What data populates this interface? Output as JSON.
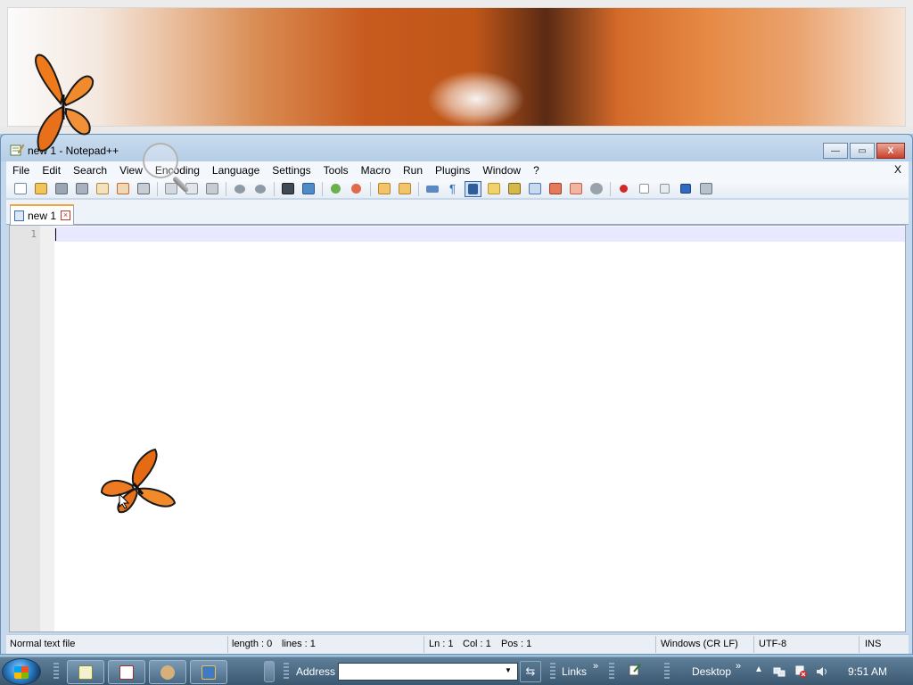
{
  "window": {
    "title": "new 1 - Notepad++",
    "close_label": "X",
    "minimize_label": "—",
    "maximize_label": "▭"
  },
  "menu": {
    "items": [
      "File",
      "Edit",
      "Search",
      "View",
      "Encoding",
      "Language",
      "Settings",
      "Tools",
      "Macro",
      "Run",
      "Plugins",
      "Window",
      "?"
    ],
    "close_label": "X"
  },
  "toolbar": {
    "buttons": [
      "new",
      "open",
      "save",
      "save-all",
      "close",
      "close-all",
      "print",
      "cut",
      "copy",
      "paste",
      "undo",
      "redo",
      "find",
      "replace",
      "zoom-in",
      "zoom-out",
      "sync-vertical",
      "sync-horizontal",
      "word-wrap",
      "show-all-chars",
      "indent-guide",
      "user-defined-language",
      "doc-map",
      "function-list",
      "folder-as-workspace",
      "monitoring",
      "record-macro",
      "stop-recording",
      "playback-macro",
      "run-macro-multiple",
      "save-macro"
    ]
  },
  "tabs": [
    {
      "label": "new 1",
      "close_label": "×"
    }
  ],
  "editor": {
    "line_numbers": [
      "1"
    ],
    "content": ""
  },
  "status": {
    "filetype": "Normal text file",
    "length": "length : 0",
    "lines": "lines : 1",
    "ln": "Ln : 1",
    "col": "Col : 1",
    "pos": "Pos : 1",
    "eol": "Windows (CR LF)",
    "encoding": "UTF-8",
    "mode": "INS"
  },
  "taskbar": {
    "address_label": "Address",
    "address_value": "",
    "links_label": "Links",
    "desktop_label": "Desktop",
    "clock": "9:51 AM",
    "chevron": "»"
  },
  "colors": {
    "accent": "#f3a43b",
    "titlebar": "#c9dcef",
    "current_line": "#e8e8ff"
  }
}
